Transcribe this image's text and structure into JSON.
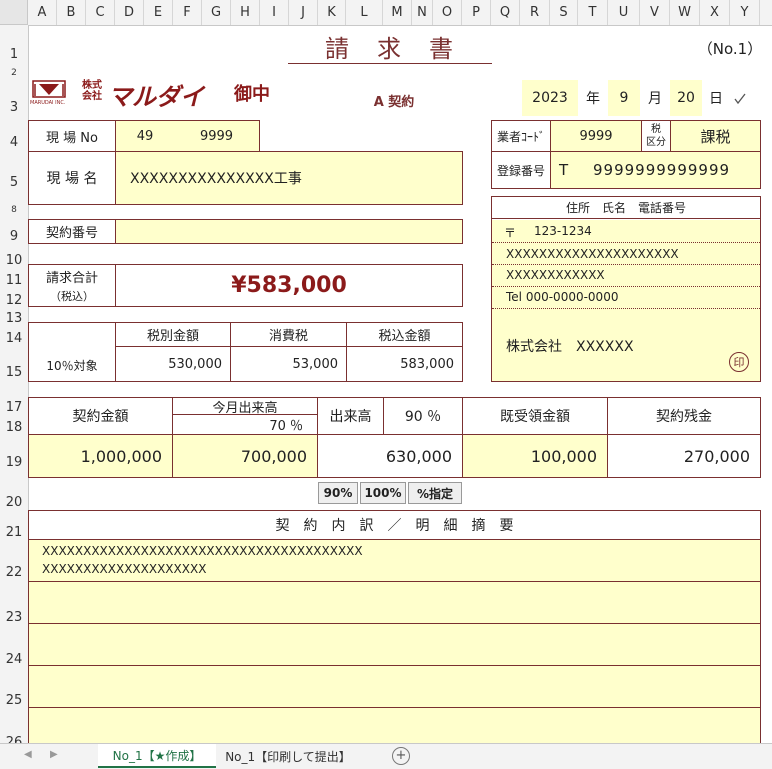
{
  "columns": [
    "A",
    "B",
    "C",
    "D",
    "E",
    "F",
    "G",
    "H",
    "I",
    "J",
    "K",
    "L",
    "M",
    "N",
    "O",
    "P",
    "Q",
    "R",
    "S",
    "T",
    "U",
    "V",
    "W",
    "X",
    "Y"
  ],
  "rows": [
    "1",
    "2",
    "3",
    "4",
    "5",
    "8",
    "9",
    "10",
    "11",
    "12",
    "13",
    "14",
    "15",
    "17",
    "18",
    "19",
    "20",
    "21",
    "22",
    "23",
    "24",
    "25",
    "26"
  ],
  "header": {
    "title": "請　求　書",
    "page_no": "（No.1）",
    "company_kabu": "株式",
    "company_kaisha": "会社",
    "company_name": "マルダイ",
    "honorific": "御中",
    "logo_sub": "MARUDAI INC.",
    "contract_type": "A 契約",
    "year": "2023",
    "year_unit": "年",
    "month": "9",
    "month_unit": "月",
    "day": "20",
    "day_unit": "日"
  },
  "site": {
    "site_no_label": "現 場 No",
    "site_no_1": "49",
    "site_no_2": "9999",
    "site_name_label": "現 場 名",
    "site_name": "XXXXXXXXXXXXXXX工事",
    "contract_no_label": "契約番号",
    "contract_no": ""
  },
  "vendor": {
    "vendor_code_label": "業者ｺｰﾄﾞ",
    "vendor_code": "9999",
    "tax_kbn_label_1": "税",
    "tax_kbn_label_2": "区分",
    "tax_kbn": "課税",
    "reg_no_label": "登録番号",
    "reg_prefix": "T",
    "reg_no": "9999999999999",
    "address_header": "住所　氏名　電話番号",
    "postal_mark": "〒",
    "postal_code": "123-1234",
    "address_1": "XXXXXXXXXXXXXXXXXXXXX",
    "address_2": "XXXXXXXXXXXX",
    "tel": "Tel  000-0000-0000",
    "company": "株式会社　XXXXXX",
    "seal": "印"
  },
  "total": {
    "label_1": "請求合計",
    "label_2": "（税込）",
    "amount": "¥583,000"
  },
  "tax_table": {
    "headers": [
      "税別金額",
      "消費税",
      "税込金額"
    ],
    "row_label": "10％対象",
    "values": [
      "530,000",
      "53,000",
      "583,000"
    ]
  },
  "progress": {
    "contract_label": "契約金額",
    "this_month_label": "今月出来高",
    "this_month_pct": "70 ％",
    "dekidaka_label": "出来高",
    "dekidaka_pct": "90 ％",
    "received_label": "既受領金額",
    "remaining_label": "契約残金",
    "contract_amount": "1,000,000",
    "this_month_amount": "700,000",
    "dekidaka_amount": "630,000",
    "received_amount": "100,000",
    "remaining_amount": "270,000"
  },
  "buttons": {
    "p90": "90%",
    "p100": "100%",
    "custom": "%指定"
  },
  "details": {
    "header": "契　約　内　訳　／　明　細　摘　要",
    "line_1": "XXXXXXXXXXXXXXXXXXXXXXXXXXXXXXXXXXXXXXX",
    "line_2": "XXXXXXXXXXXXXXXXXXXX"
  },
  "tabs": {
    "active": "No_1【★作成】",
    "second": "No_1【印刷して提出】",
    "add": "+"
  }
}
